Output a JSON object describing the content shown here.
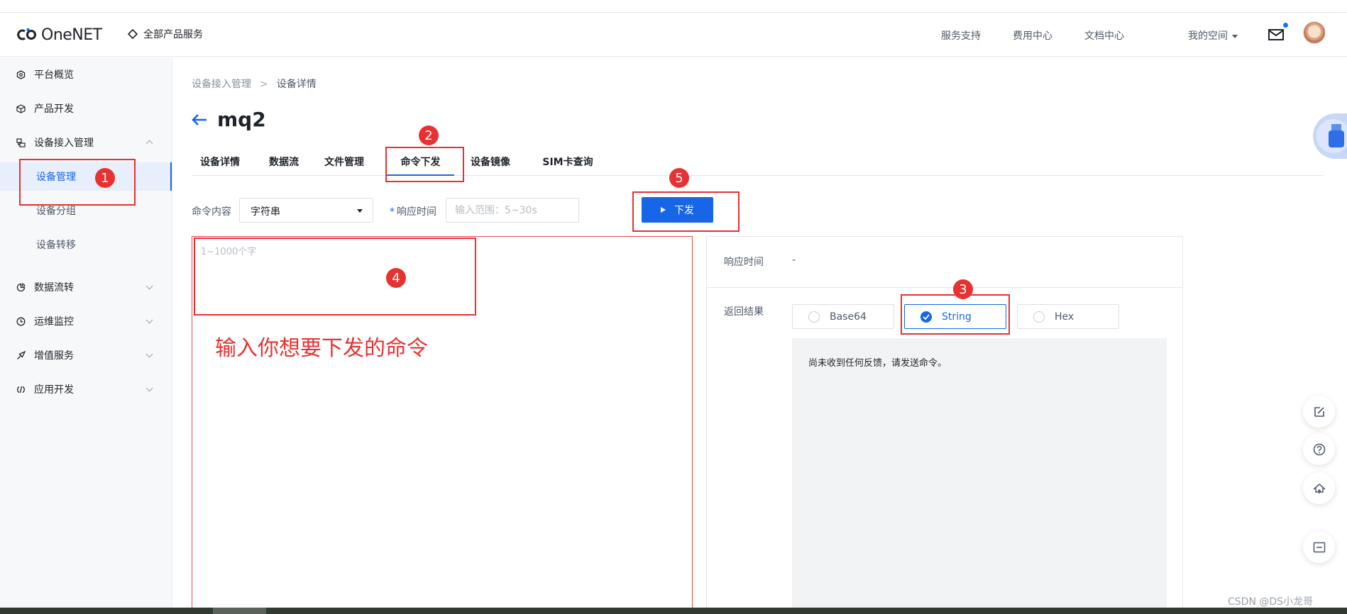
{
  "header": {
    "logo_text": "OneNET",
    "all_products": "全部产品服务",
    "nav": [
      "服务支持",
      "费用中心",
      "文档中心",
      "我的空间"
    ]
  },
  "sidebar": {
    "items": [
      {
        "label": "平台概览",
        "icon": "overview-icon"
      },
      {
        "label": "产品开发",
        "icon": "cube-icon"
      },
      {
        "label": "设备接入管理",
        "icon": "device-access-icon"
      },
      {
        "label": "数据流转",
        "icon": "data-flow-icon"
      },
      {
        "label": "运维监控",
        "icon": "monitor-icon"
      },
      {
        "label": "增值服务",
        "icon": "value-added-icon"
      },
      {
        "label": "应用开发",
        "icon": "app-dev-icon"
      }
    ],
    "subitems": [
      "设备管理",
      "设备分组",
      "设备转移"
    ]
  },
  "breadcrumb": {
    "parent": "设备接入管理",
    "sep": ">",
    "current": "设备详情"
  },
  "page": {
    "title": "mq2"
  },
  "tabs": [
    "设备详情",
    "数据流",
    "文件管理",
    "命令下发",
    "设备镜像",
    "SIM卡查询"
  ],
  "form": {
    "cmd_label": "命令内容",
    "cmd_type": "字符串",
    "resp_label": "响应时间",
    "resp_required": "*",
    "resp_placeholder": "输入范围：5~30s",
    "send_button": "下发",
    "textarea_placeholder": "1~1000个字"
  },
  "annotation_hint": "输入你想要下发的命令",
  "result_panel": {
    "resp_time_label": "响应时间",
    "resp_time_value": "-",
    "result_label": "返回结果",
    "formats": [
      "Base64",
      "String",
      "Hex"
    ],
    "selected_format": "String",
    "result_text": "尚未收到任何反馈，请发送命令。"
  },
  "badges": [
    "1",
    "2",
    "3",
    "4",
    "5"
  ],
  "watermark": "CSDN @DS小龙哥",
  "colors": {
    "accent": "#1766e8",
    "annotation": "#e83131"
  }
}
